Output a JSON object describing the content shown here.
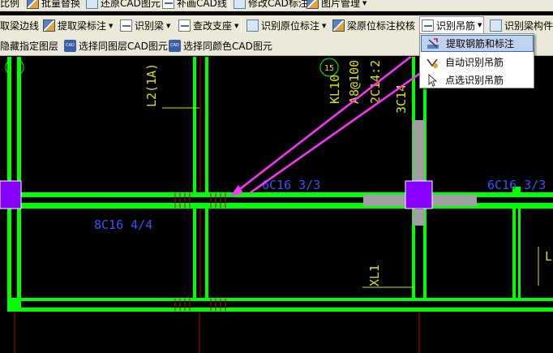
{
  "toolbar_row0": {
    "items": [
      {
        "label": "比例"
      },
      {
        "label": "批量替换"
      },
      {
        "label": "还原CAD图元"
      },
      {
        "label": "补画CAD线"
      },
      {
        "label": "修改CAD标注"
      },
      {
        "label": "图片管理"
      }
    ]
  },
  "toolbar_row1": {
    "items": [
      {
        "label": "取梁边线"
      },
      {
        "label": "提取梁标注"
      },
      {
        "label": "识别梁"
      },
      {
        "label": "查改支座"
      },
      {
        "label": "识别原位标注"
      },
      {
        "label": "梁原位标注校核"
      },
      {
        "label": "识别吊筋"
      },
      {
        "label": "识别梁构件"
      }
    ]
  },
  "toolbar_row2": {
    "items": [
      {
        "label": "隐藏指定图层"
      },
      {
        "label": "选择同图层CAD图元"
      },
      {
        "label": "选择同颜色CAD图元"
      }
    ]
  },
  "hanger_menu": {
    "items": [
      {
        "label": "提取钢筋和标注"
      },
      {
        "label": "自动识别吊筋"
      },
      {
        "label": "点选识别吊筋"
      }
    ]
  },
  "drawing": {
    "axis_left": "1",
    "axis_mid": "15",
    "beam_labels": {
      "l2": "L2(1A)",
      "kl": "KL10",
      "a8": "A8@100",
      "c14": "2C14:2",
      "c3": "3C14",
      "bar1": "6C16 3/3",
      "bar2": "8C16 4/4",
      "bar3": "6C16 3/3",
      "xl": "XL1",
      "lr": "L"
    }
  },
  "colors": {
    "beam": "#00ff00",
    "column": "#8800ff",
    "support": "#a0a0a0",
    "arrow": "#ff33ff",
    "label_blue": "#3355ff",
    "label_yellow": "#e0e000"
  }
}
